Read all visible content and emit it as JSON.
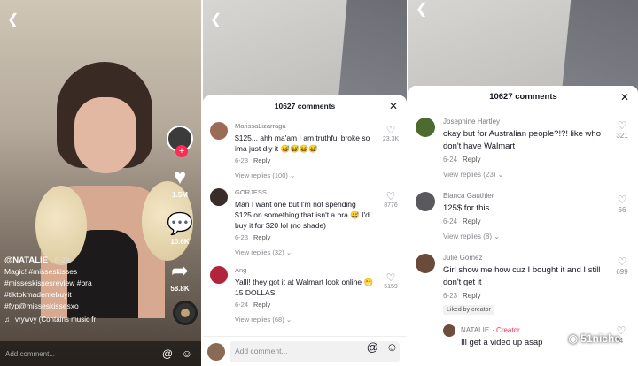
{
  "panel1": {
    "username": "@NATALIE",
    "date": "6-28",
    "caption_lines": [
      "Magic! #misseskisses",
      "#misseskissesreview #bra",
      "#tiktokmademebuyit",
      "#fyp@misseskissesxo"
    ],
    "music": "vrywvy (Contains music fr",
    "likes": "1.5M",
    "comments_count": "10.6K",
    "shares": "58.8K",
    "add_comment": "Add comment..."
  },
  "panel2": {
    "header": "10627 comments",
    "comments": [
      {
        "name": "MarissaLizarraga",
        "text": "$125... ahh ma'am I am truthful broke so ima just diy it 😅😅😅😅",
        "date": "6-23",
        "reply": "Reply",
        "likes": "23.3K",
        "replies": "View replies (100)"
      },
      {
        "name": "GORJESS",
        "text": "Man I want one but I'm not spending $125 on something that isn't a bra 😅 I'd buy it for $20 lol (no shade)",
        "date": "6-23",
        "reply": "Reply",
        "likes": "8776",
        "replies": "View replies (32)"
      },
      {
        "name": "Ang",
        "text": "Yalll! they got it at Walmart look online 😁 15 DOLLAS",
        "date": "6-24",
        "reply": "Reply",
        "likes": "5159",
        "replies": "View replies (68)"
      }
    ],
    "add_comment": "Add comment..."
  },
  "panel3": {
    "header": "10627 comments",
    "comments": [
      {
        "name": "Josephine Hartley",
        "text": "okay but for Australian people?!?! like who don't have Walmart",
        "date": "6-24",
        "reply": "Reply",
        "likes": "321",
        "replies": "View replies (23)"
      },
      {
        "name": "Bianca Gauthier",
        "text": "125$ for this",
        "date": "6-24",
        "reply": "Reply",
        "likes": "66",
        "replies": "View replies (8)"
      },
      {
        "name": "Julie Gomez",
        "text": "Girl show me how cuz I bought it and I still don't get it",
        "date": "6-23",
        "reply": "Reply",
        "likes": "699",
        "liked_by_creator": "Liked by creator"
      }
    ],
    "reply": {
      "name": "NATALIE",
      "badge": "· Creator",
      "text": "Ill get a video up asap"
    },
    "likes_last": "4"
  },
  "watermark": "51niche",
  "icons": {
    "back": "chevron-left-icon",
    "heart": "heart-icon",
    "comment": "comment-bubble-icon",
    "share": "share-arrow-icon",
    "close": "close-icon",
    "at": "at-sign-icon",
    "emoji": "emoji-icon"
  },
  "colors": {
    "accent": "#fe2c55",
    "text": "#161823",
    "muted": "#8a8b91"
  }
}
